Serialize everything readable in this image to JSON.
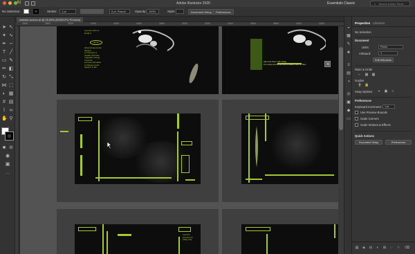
{
  "app": {
    "title": "Adobe Illustrator 2020",
    "workspace": "Essentials Classic",
    "search_placeholder": "Search Adobe Stock"
  },
  "control_bar": {
    "selection": "No Selection",
    "stroke_label": "Stroke:",
    "stroke_value": "1 pt",
    "brush_value": "5 pt. Round",
    "opacity_label": "Opacity:",
    "opacity_value": "100%",
    "style_label": "Style:",
    "doc_setup": "Document Setup",
    "preferences": "Preferences"
  },
  "document_tab": {
    "label": "website-screen.ai @ 25.65% (RGB/CPU Preview)"
  },
  "ruler": {
    "ticks": [
      "1600",
      "1800",
      "2000",
      "2200",
      "2400",
      "2600",
      "2800",
      "3000",
      "3200",
      "3400",
      "3600",
      "3800",
      "4000",
      "4200"
    ]
  },
  "artwork": {
    "t1_quote": "a person who is\nkindly 2",
    "t1_oval": "quote",
    "t1_body": "discovering events\nhappen\nin moments a\nheader with less\nmagnetic energy.\nTrust the\nprocess and allow\na change to just\nhappen in life.",
    "t2_caption": "trust the\nprocess for\ntoday only",
    "t2_banner": "ask trust them with today\nit's a step and kinda find a header with no flow"
  },
  "panel": {
    "tabs": [
      "Properties",
      "Libraries"
    ],
    "no_selection": "No Selection",
    "document": "Document",
    "units_label": "Units:",
    "units_value": "Pixels",
    "artboard_label": "Artboard:",
    "artboard_value": "1",
    "edit_artboards": "Edit Artboards",
    "ruler_grids": "Ruler & Grids",
    "guides": "Guides",
    "snap_options": "Snap Options",
    "preferences": "Preferences",
    "keyboard_increment_label": "Keyboard Increment:",
    "keyboard_increment_value": "1 pt",
    "check_preview_bounds": "Use Preview Bounds",
    "check_scale_corners": "Scale Corners",
    "check_scale_strokes": "Scale Strokes & Effects",
    "quick_actions": "Quick Actions",
    "btn_document_setup": "Document Setup",
    "btn_preferences": "Preferences"
  },
  "colors": {
    "accent_lime": "#a6c934",
    "canvas_bg": "#535353",
    "artboard_bg": "#0d0d0d"
  }
}
